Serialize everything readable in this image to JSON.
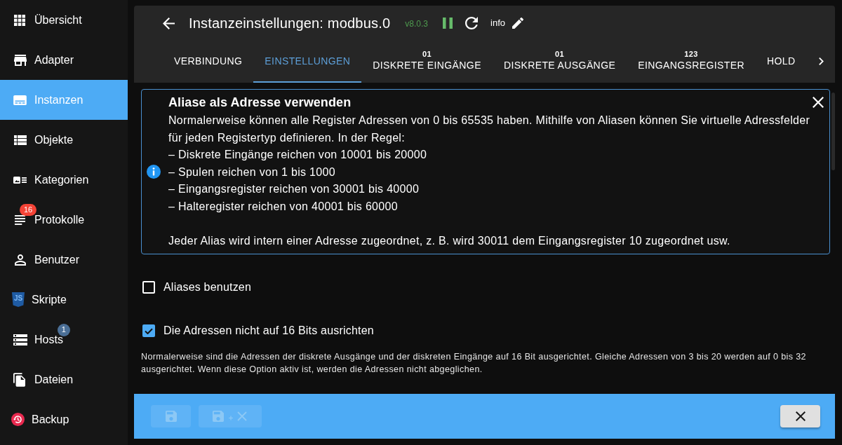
{
  "sidebar": {
    "items": [
      {
        "label": "Übersicht",
        "selected": false
      },
      {
        "label": "Adapter",
        "selected": false
      },
      {
        "label": "Instanzen",
        "selected": true
      },
      {
        "label": "Objekte",
        "selected": false
      },
      {
        "label": "Kategorien",
        "selected": false
      },
      {
        "label": "Protokolle",
        "selected": false,
        "badge": {
          "text": "16",
          "color": "#f44336",
          "kind": "icon"
        }
      },
      {
        "label": "Benutzer",
        "selected": false
      },
      {
        "label": "Skripte",
        "selected": false,
        "logo_text": "JS"
      },
      {
        "label": "Hosts",
        "selected": false,
        "badge": {
          "text": "1",
          "color": "#4b6f96",
          "kind": "label"
        }
      },
      {
        "label": "Dateien",
        "selected": false
      },
      {
        "label": "Backup",
        "selected": false
      }
    ]
  },
  "header": {
    "title": "Instanzeinstellungen: modbus.0",
    "version": "v8.0.3",
    "running": true,
    "info_label": "info"
  },
  "tabs": [
    {
      "label": "VERBINDUNG",
      "selected": false
    },
    {
      "label": "EINSTELLUNGEN",
      "selected": true
    },
    {
      "label": "DISKRETE EINGÄNGE",
      "selected": false,
      "icon_text": "01"
    },
    {
      "label": "DISKRETE AUSGÄNGE",
      "selected": false,
      "icon_text": "01"
    },
    {
      "label": "EINGANGSREGISTER",
      "selected": false,
      "icon_text": "123"
    },
    {
      "label": "HOLD",
      "selected": false
    }
  ],
  "info_alert": {
    "title": "Aliase als Adresse verwenden",
    "intro": "Normalerweise können alle Register Adressen von 0 bis 65535 haben. Mithilfe von Aliasen können Sie virtuelle Adressfelder für jeden Registertyp definieren. In der Regel:",
    "ranges": [
      "– Diskrete Eingänge reichen von 10001 bis 20000",
      "– Spulen reichen von 1 bis 1000",
      "– Eingangsregister reichen von 30001 bis 40000",
      "– Halteregister reichen von 40001 bis 60000"
    ],
    "note": "Jeder Alias wird intern einer Adresse zugeordnet, z. B. wird 30011 dem Eingangsregister 10 zugeordnet usw."
  },
  "options": [
    {
      "label": "Aliases benutzen",
      "checked": false
    },
    {
      "label": "Die Adressen nicht auf 16 Bits ausrichten",
      "checked": true,
      "help": "Normalerweise sind die Adressen der diskrete Ausgänge und der diskreten Eingänge auf 16 Bit ausgerichtet. Gleiche Adressen von 3 bis 20 werden auf 0 bis 32 ausgerichtet. Wenn diese Option aktiv ist, werden die Adressen nicht abgeglichen."
    }
  ],
  "footer": {
    "buttons": [
      {
        "kind": "save",
        "disabled": true
      },
      {
        "kind": "save-close",
        "disabled": true
      },
      {
        "kind": "close",
        "disabled": false
      }
    ]
  }
}
